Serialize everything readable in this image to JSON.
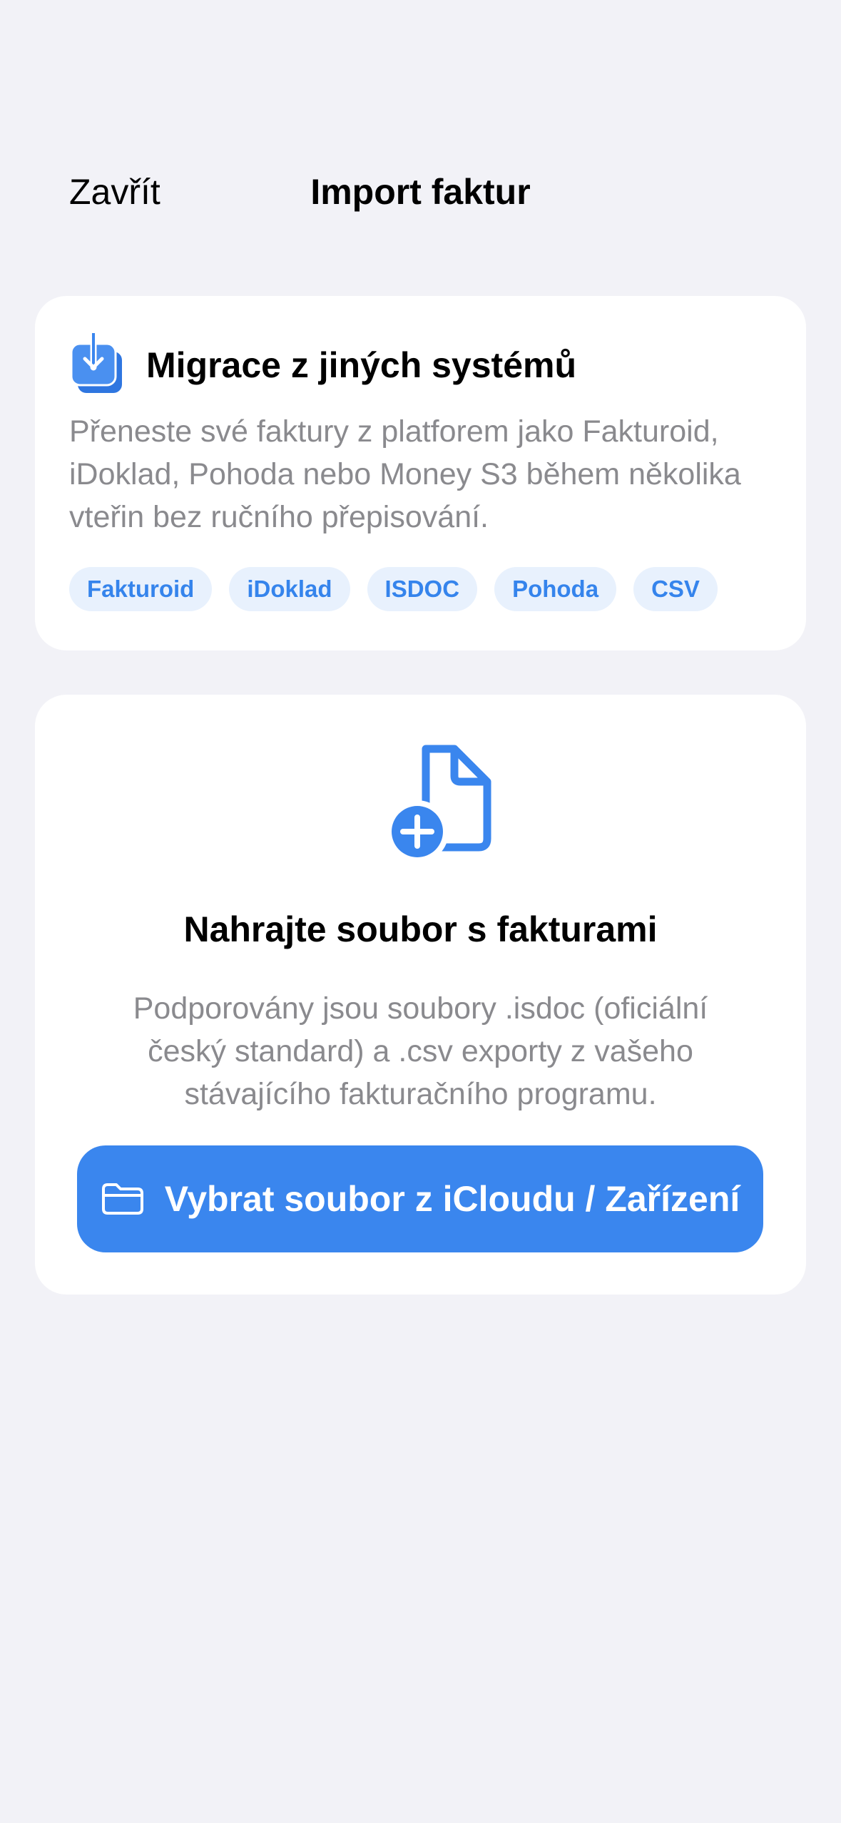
{
  "nav": {
    "close_label": "Zavřít",
    "title": "Import faktur"
  },
  "migration": {
    "icon": "tray-download-icon",
    "title": "Migrace z jiných systémů",
    "description": "Přeneste své faktury z platforem jako Fakturoid, iDoklad, Pohoda nebo Money S3 během několika vteřin bez ručního přepisování.",
    "tags": [
      "Fakturoid",
      "iDoklad",
      "ISDOC",
      "Pohoda",
      "CSV"
    ]
  },
  "upload": {
    "icon": "document-add-icon",
    "title": "Nahrajte soubor s fakturami",
    "description": "Podporovány jsou soubory .isdoc (oficiální český standard) a .csv exporty z vašeho stávajícího fakturačního programu.",
    "button_icon": "folder-icon",
    "button_label": "Vybrat soubor z iCloudu / Zařízení"
  },
  "colors": {
    "accent": "#3a86ee",
    "tag_background": "#e8f1fd",
    "background": "#f2f2f7",
    "secondary_text": "#8a8a8e"
  }
}
